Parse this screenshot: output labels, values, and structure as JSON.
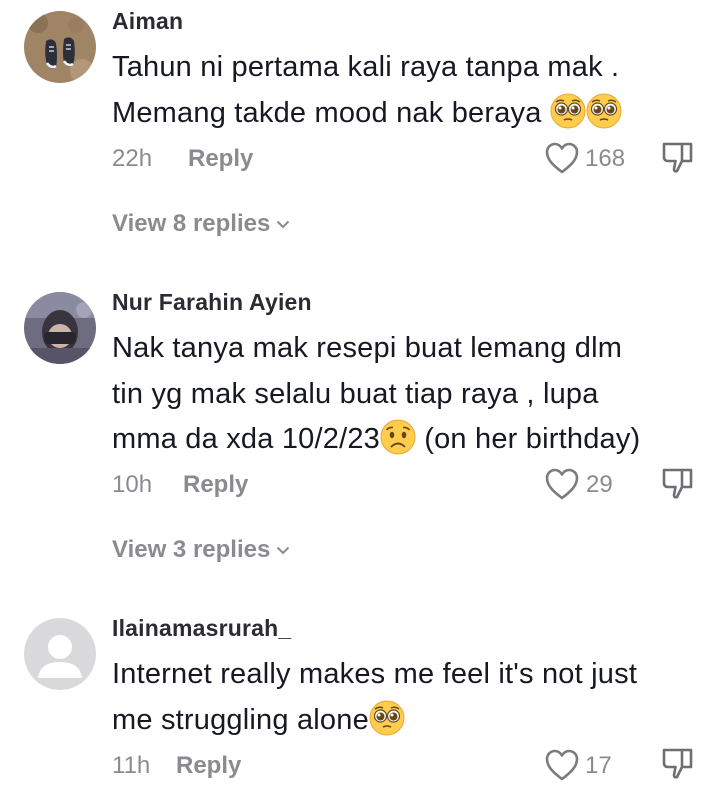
{
  "comments": [
    {
      "username": "Aiman",
      "text_lines": [
        "Tahun ni pertama kali raya tanpa mak .",
        "Memang takde mood nak beraya"
      ],
      "emojis_line2": [
        "pleading-face",
        "pleading-face"
      ],
      "time": "22h",
      "reply_label": "Reply",
      "likes": "168",
      "view_replies": "View 8 replies"
    },
    {
      "username": "Nur Farahin Ayien",
      "text_lines": [
        "Nak tanya mak resepi buat lemang dlm",
        "tin yg mak selalu buat tiap raya , lupa",
        "mma da xda 10/2/23",
        " (on her birthday)"
      ],
      "emojis_line3": [
        "worried-face"
      ],
      "time": "10h",
      "reply_label": "Reply",
      "likes": "29",
      "view_replies": "View 3 replies"
    },
    {
      "username": "Ilainamasrurah_",
      "text_lines": [
        "Internet really makes me feel it's not just",
        "me struggling alone"
      ],
      "emojis_line2": [
        "pleading-face"
      ],
      "time": "11h",
      "reply_label": "Reply",
      "likes": "17"
    }
  ],
  "icons": {
    "like": "heart-outline-icon",
    "dislike": "thumbs-down-icon",
    "chevron": "chevron-down-icon"
  },
  "colors": {
    "text": "#161823",
    "secondary": "#8a8b91",
    "background": "#ffffff"
  }
}
